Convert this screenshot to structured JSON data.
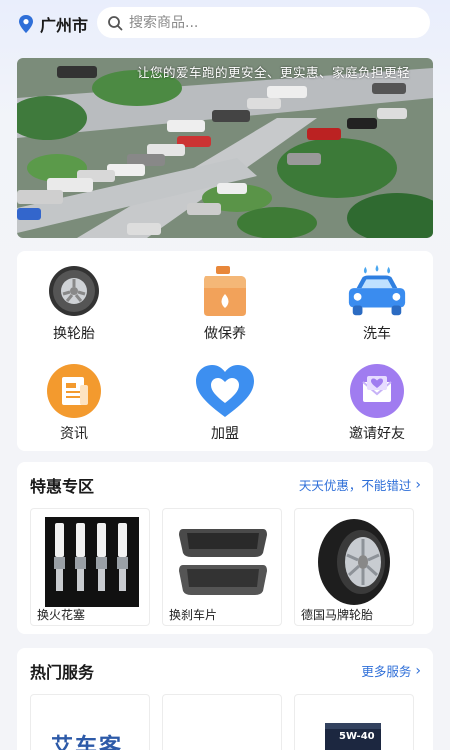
{
  "header": {
    "city": "广州市",
    "search_placeholder": "搜索商品..."
  },
  "banner": {
    "caption": "让您的爱车跑的更安全、更实惠、家庭负担更轻"
  },
  "categories": [
    {
      "label": "换轮胎",
      "icon": "tire-icon"
    },
    {
      "label": "做保养",
      "icon": "oil-can-icon"
    },
    {
      "label": "洗车",
      "icon": "car-wash-icon"
    },
    {
      "label": "资讯",
      "icon": "news-icon"
    },
    {
      "label": "加盟",
      "icon": "heart-icon"
    },
    {
      "label": "邀请好友",
      "icon": "invite-icon"
    }
  ],
  "special": {
    "title": "特惠专区",
    "more": "天天优惠，不能错过",
    "products": [
      {
        "name": "换火花塞"
      },
      {
        "name": "换刹车片"
      },
      {
        "name": "德国马牌轮胎"
      }
    ]
  },
  "hot": {
    "title": "热门服务",
    "more": "更多服务",
    "items": [
      {
        "text": "艾车客"
      },
      {
        "text": ""
      },
      {
        "text": "5W-40"
      }
    ]
  },
  "colors": {
    "accent": "#2f6fd8",
    "location": "#2f6fd8",
    "background": "#f3f4f8"
  }
}
